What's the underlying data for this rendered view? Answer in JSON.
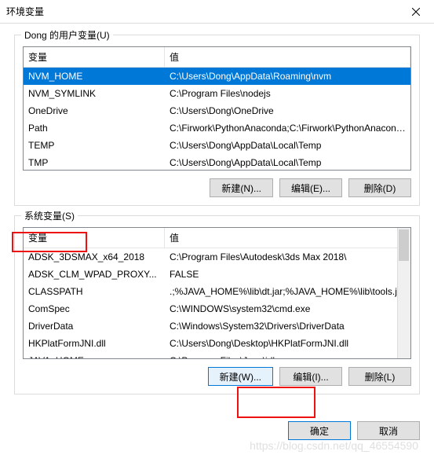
{
  "title": "环境变量",
  "user_section": {
    "legend": "Dong 的用户变量(U)",
    "headers": {
      "var": "变量",
      "val": "值"
    },
    "rows": [
      {
        "var": "NVM_HOME",
        "val": "C:\\Users\\Dong\\AppData\\Roaming\\nvm",
        "selected": true
      },
      {
        "var": "NVM_SYMLINK",
        "val": "C:\\Program Files\\nodejs"
      },
      {
        "var": "OneDrive",
        "val": "C:\\Users\\Dong\\OneDrive"
      },
      {
        "var": "Path",
        "val": "C:\\Firwork\\PythonAnaconda;C:\\Firwork\\PythonAnaconda\\Libr..."
      },
      {
        "var": "TEMP",
        "val": "C:\\Users\\Dong\\AppData\\Local\\Temp"
      },
      {
        "var": "TMP",
        "val": "C:\\Users\\Dong\\AppData\\Local\\Temp"
      }
    ],
    "buttons": {
      "new": "新建(N)...",
      "edit": "编辑(E)...",
      "delete": "删除(D)"
    }
  },
  "system_section": {
    "legend": "系统变量(S)",
    "headers": {
      "var": "变量",
      "val": "值"
    },
    "rows": [
      {
        "var": "ADSK_3DSMAX_x64_2018",
        "val": "C:\\Program Files\\Autodesk\\3ds Max 2018\\"
      },
      {
        "var": "ADSK_CLM_WPAD_PROXY...",
        "val": "FALSE"
      },
      {
        "var": "CLASSPATH",
        "val": ".;%JAVA_HOME%\\lib\\dt.jar;%JAVA_HOME%\\lib\\tools.jar"
      },
      {
        "var": "ComSpec",
        "val": "C:\\WINDOWS\\system32\\cmd.exe"
      },
      {
        "var": "DriverData",
        "val": "C:\\Windows\\System32\\Drivers\\DriverData"
      },
      {
        "var": "HKPlatFormJNI.dll",
        "val": "C:\\Users\\Dong\\Desktop\\HKPlatFormJNI.dll"
      },
      {
        "var": "JAVA_HOME",
        "val": "C:\\Program Files\\Java\\jdk"
      }
    ],
    "buttons": {
      "new": "新建(W)...",
      "edit": "编辑(I)...",
      "delete": "删除(L)"
    }
  },
  "dialog_buttons": {
    "ok": "确定",
    "cancel": "取消"
  },
  "watermark": "https://blog.csdn.net/qq_46554590"
}
